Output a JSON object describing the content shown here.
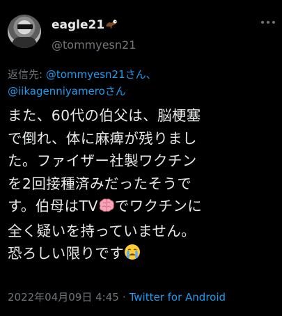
{
  "author": {
    "display_name": "eagle21",
    "handle": "@tommyesn21",
    "name_badge_icon": "eagle-emoji-icon",
    "avatar_icon": "user-avatar"
  },
  "reply_context": {
    "prefix": "返信先: ",
    "mention_1": "@tommyesn21さん",
    "separator": "、",
    "mention_2": "@iikagenniyameroさん"
  },
  "tweet": {
    "line_1": "また、60代の伯父は、脳梗塞",
    "line_2": "で倒れ、体に麻痺が残りまし",
    "line_3": "た。ファイザー社製ワクチン",
    "line_4": "を2回接種済みだったそうで",
    "line_5a": "す。伯母はTV",
    "line_5_emoji_icon": "brain-emoji-icon",
    "line_5b": "でワクチンに",
    "line_6": "全く疑いを持っていません。",
    "line_7": "恐ろしい限りです",
    "line_7_emoji_icon": "crying-face-emoji-icon"
  },
  "footer": {
    "timestamp": "2022年04月09日 4:45",
    "separator": "·",
    "source": "Twitter for Android"
  },
  "colors": {
    "background": "#000000",
    "text_primary": "#e7e9ea",
    "text_secondary": "#71767b",
    "link": "#1d9bf0"
  }
}
